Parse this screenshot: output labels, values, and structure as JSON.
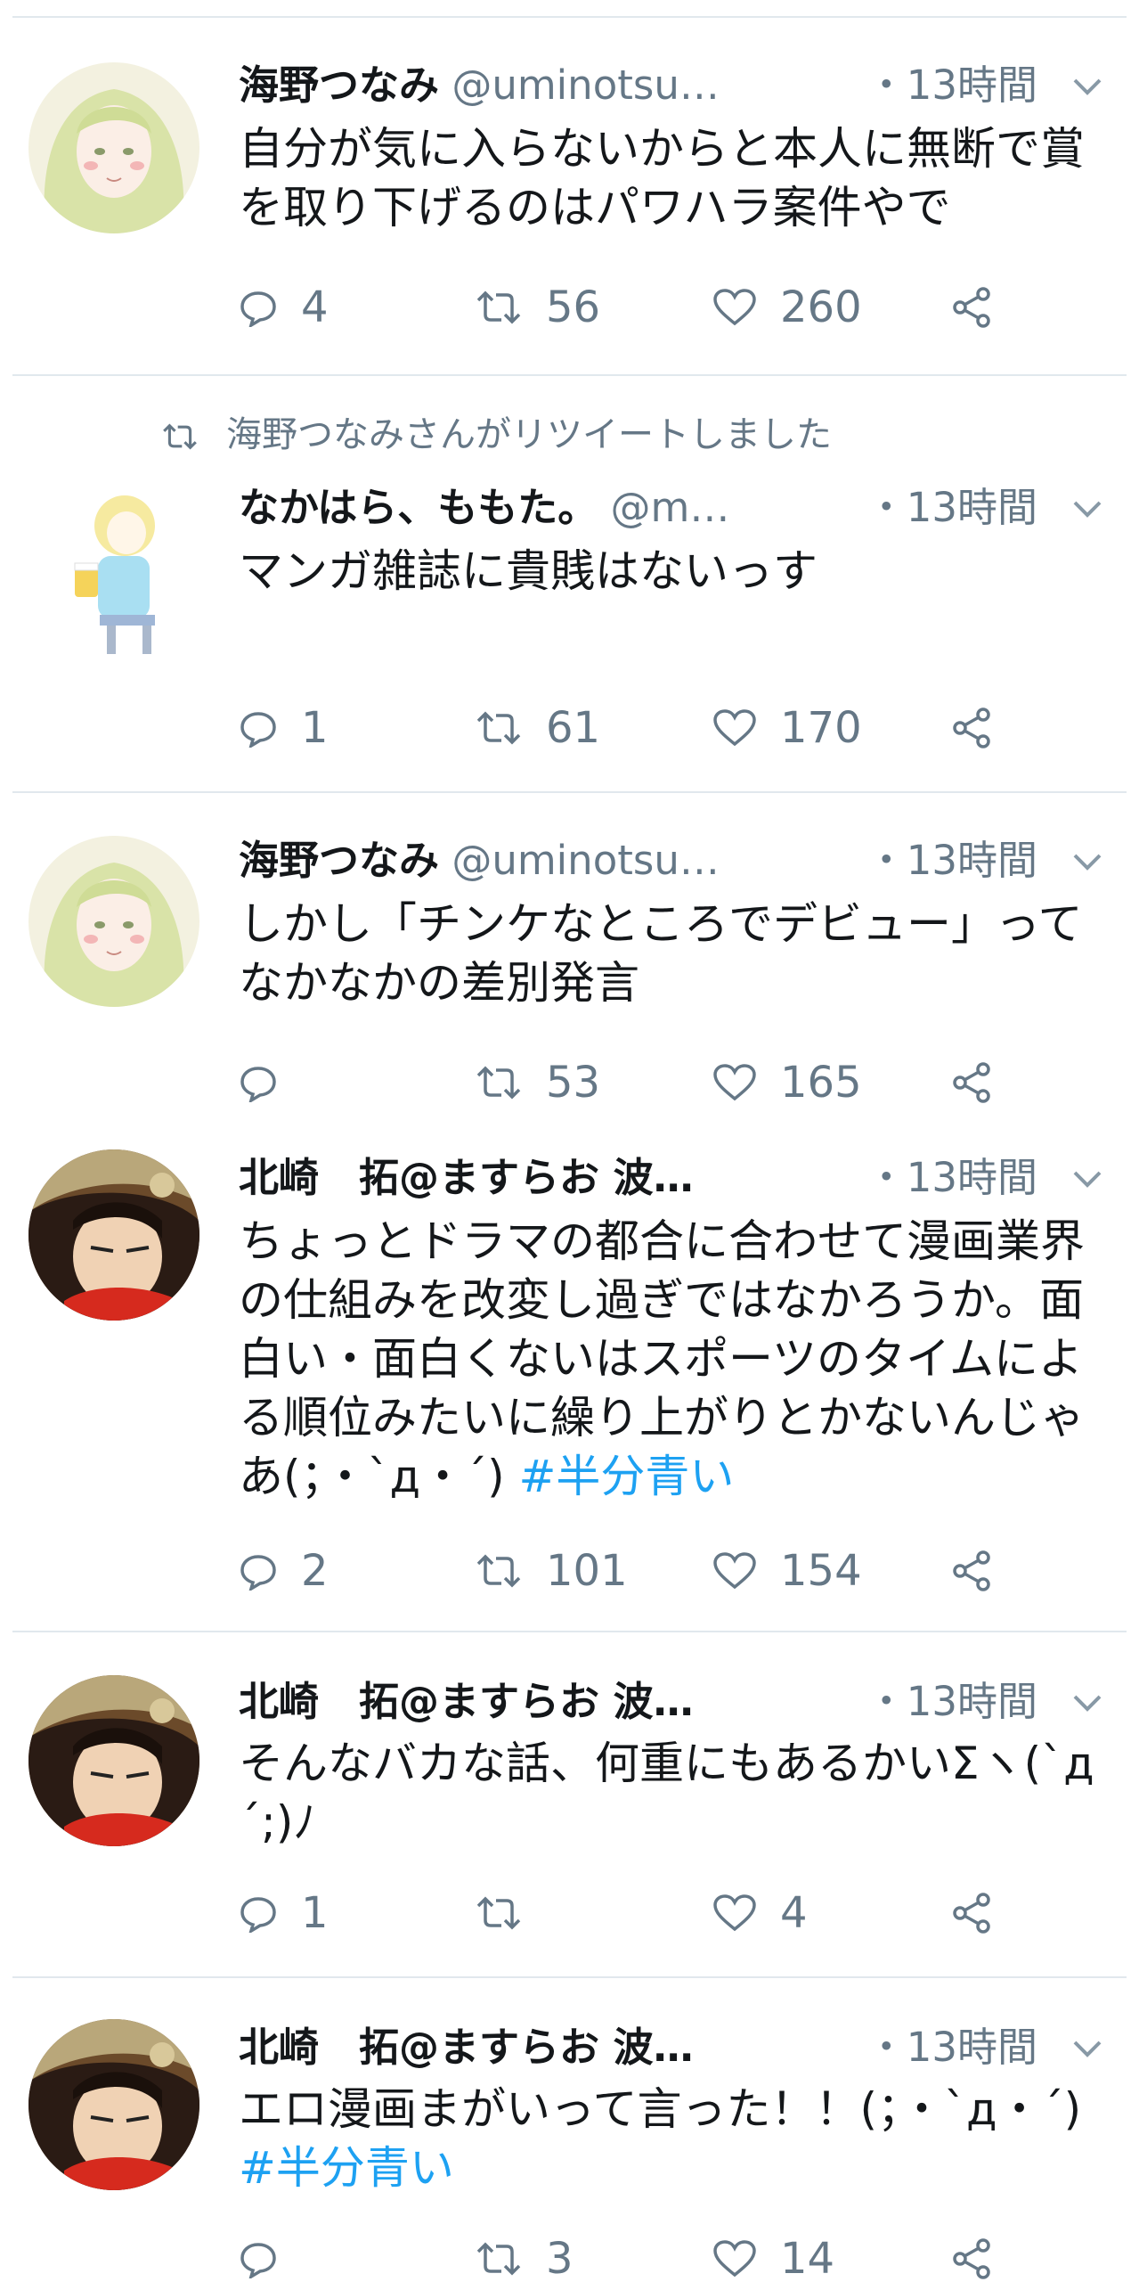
{
  "tweets": [
    {
      "name": "海野つなみ",
      "handle": "@uminotsu…",
      "time": "・13時間",
      "text": "自分が気に入らないからと本人に無断で賞を取り下げるのはパワハラ案件やで",
      "replies": "4",
      "retweets": "56",
      "likes": "260"
    },
    {
      "retweet_notice": "海野つなみさんがリツイートしました",
      "name": "なかはら、ももた。",
      "handle": "@m…",
      "time": "・13時間",
      "text": "マンガ雑誌に貴賎はないっす",
      "replies": "1",
      "retweets": "61",
      "likes": "170"
    },
    {
      "name": "海野つなみ",
      "handle": "@uminotsu…",
      "time": "・13時間",
      "text": "しかし「チンケなところでデビュー」ってなかなかの差別発言",
      "replies": "",
      "retweets": "53",
      "likes": "165"
    },
    {
      "name": "北崎　拓@ますらお 波…",
      "handle": "",
      "time": "・13時間",
      "text": "ちょっとドラマの都合に合わせて漫画業界の仕組みを改変し過ぎではなかろうか。面白い・面白くないはスポーツのタイムによる順位みたいに繰り上がりとかないんじゃあ(；・`д・´)",
      "hashtag": "#半分青い",
      "replies": "2",
      "retweets": "101",
      "likes": "154"
    },
    {
      "name": "北崎　拓@ますらお 波…",
      "handle": "",
      "time": "・13時間",
      "text": "そんなバカな話、何重にもあるかいΣヽ(`д´;)ﾉ",
      "replies": "1",
      "retweets": "",
      "likes": "4"
    },
    {
      "name": "北崎　拓@ますらお 波…",
      "handle": "",
      "time": "・13時間",
      "text": "エロ漫画まがいって言った！！(；・`д・´)",
      "hashtag": "#半分青い",
      "replies": "",
      "retweets": "3",
      "likes": "14"
    }
  ],
  "icons": {
    "reply": "reply-icon",
    "retweet": "retweet-icon",
    "like": "heart-icon",
    "share": "share-icon",
    "menu": "chevron-down-icon"
  },
  "colors": {
    "text": "#14171a",
    "muted": "#657786",
    "link": "#1da1f2",
    "divider": "#e1e8ed"
  }
}
